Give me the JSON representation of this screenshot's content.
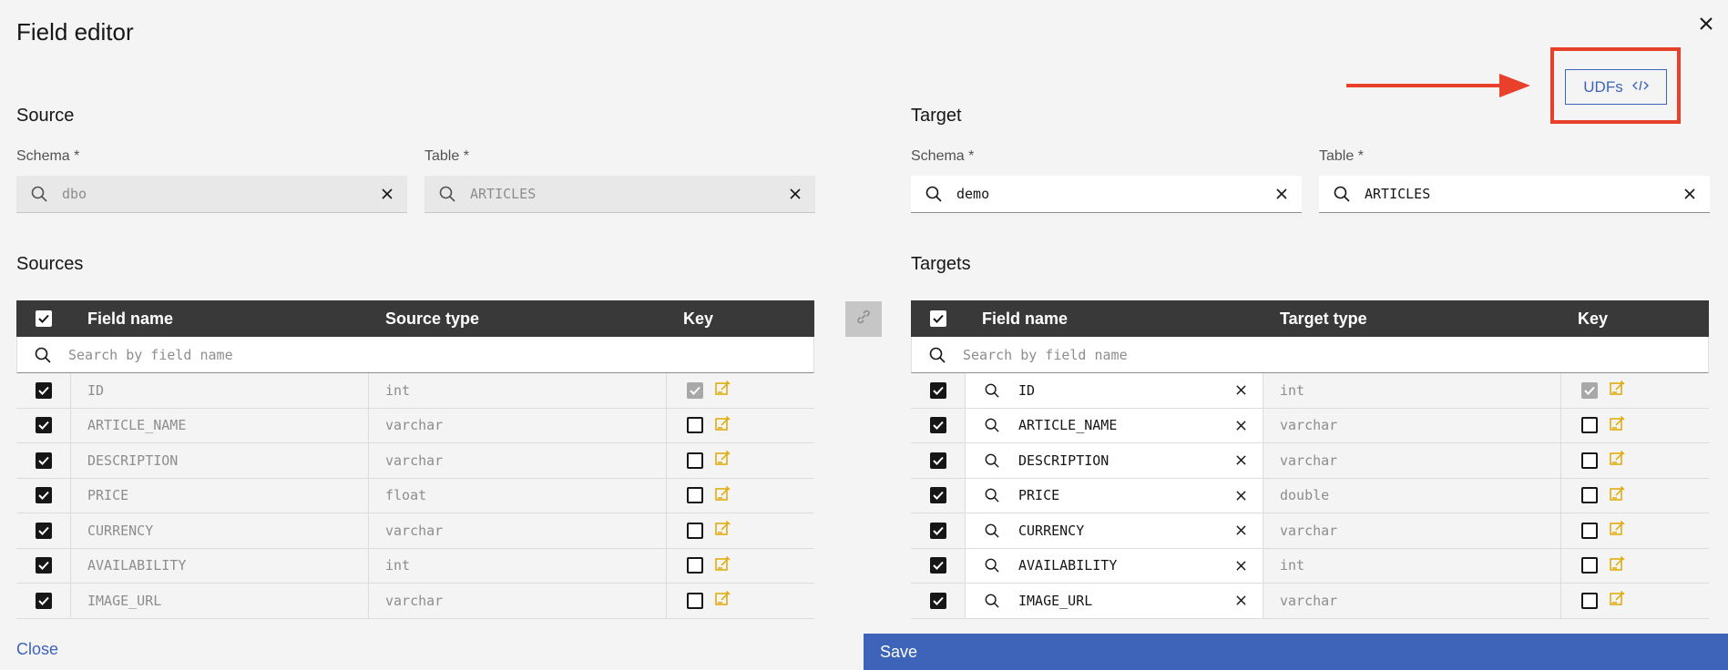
{
  "dialog": {
    "title": "Field editor",
    "close_label": "Close",
    "save_label": "Save"
  },
  "udf_button": {
    "label": "UDFs",
    "icon": "code-icon",
    "highlight_color": "#e8402a"
  },
  "source": {
    "heading": "Source",
    "schema_label": "Schema *",
    "schema_value": "dbo",
    "table_label": "Table *",
    "table_value": "ARTICLES"
  },
  "target": {
    "heading": "Target",
    "schema_label": "Schema *",
    "schema_value": "demo",
    "table_label": "Table *",
    "table_value": "ARTICLES"
  },
  "sources_table": {
    "heading": "Sources",
    "columns": [
      "Field name",
      "Source type",
      "Key"
    ],
    "search_placeholder": "Search by field name",
    "rows": [
      {
        "field": "ID",
        "type": "int",
        "selected": true,
        "key": true,
        "key_disabled": true
      },
      {
        "field": "ARTICLE_NAME",
        "type": "varchar",
        "selected": true,
        "key": false
      },
      {
        "field": "DESCRIPTION",
        "type": "varchar",
        "selected": true,
        "key": false
      },
      {
        "field": "PRICE",
        "type": "float",
        "selected": true,
        "key": false
      },
      {
        "field": "CURRENCY",
        "type": "varchar",
        "selected": true,
        "key": false
      },
      {
        "field": "AVAILABILITY",
        "type": "int",
        "selected": true,
        "key": false
      },
      {
        "field": "IMAGE_URL",
        "type": "varchar",
        "selected": true,
        "key": false
      }
    ]
  },
  "targets_table": {
    "heading": "Targets",
    "columns": [
      "Field name",
      "Target type",
      "Key"
    ],
    "search_placeholder": "Search by field name",
    "rows": [
      {
        "field": "ID",
        "type": "int",
        "selected": true,
        "key": true,
        "key_disabled": true
      },
      {
        "field": "ARTICLE_NAME",
        "type": "varchar",
        "selected": true,
        "key": false
      },
      {
        "field": "DESCRIPTION",
        "type": "varchar",
        "selected": true,
        "key": false
      },
      {
        "field": "PRICE",
        "type": "double",
        "selected": true,
        "key": false
      },
      {
        "field": "CURRENCY",
        "type": "varchar",
        "selected": true,
        "key": false
      },
      {
        "field": "AVAILABILITY",
        "type": "int",
        "selected": true,
        "key": false
      },
      {
        "field": "IMAGE_URL",
        "type": "varchar",
        "selected": true,
        "key": false
      }
    ]
  },
  "colors": {
    "primary": "#3d64b8",
    "header_bg": "#393939",
    "edit_icon": "#e0a800"
  }
}
